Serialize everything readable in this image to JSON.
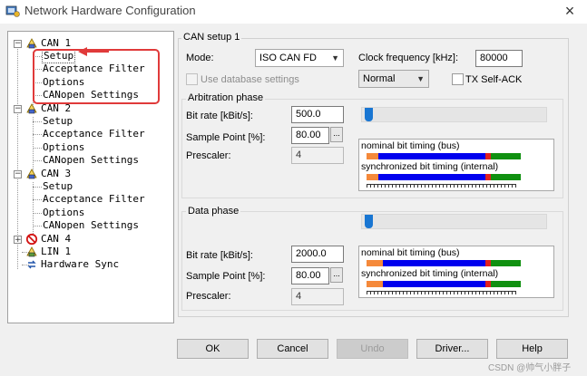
{
  "window": {
    "title": "Network Hardware Configuration",
    "close_glyph": "×"
  },
  "tree": {
    "nodes": [
      {
        "label": "CAN 1"
      },
      {
        "label": "Setup"
      },
      {
        "label": "Acceptance Filter"
      },
      {
        "label": "Options"
      },
      {
        "label": "CANopen Settings"
      },
      {
        "label": "CAN 2"
      },
      {
        "label": "Setup"
      },
      {
        "label": "Acceptance Filter"
      },
      {
        "label": "Options"
      },
      {
        "label": "CANopen Settings"
      },
      {
        "label": "CAN 3"
      },
      {
        "label": "Setup"
      },
      {
        "label": "Acceptance Filter"
      },
      {
        "label": "Options"
      },
      {
        "label": "CANopen Settings"
      },
      {
        "label": "CAN 4"
      },
      {
        "label": "LIN 1"
      },
      {
        "label": "Hardware Sync"
      }
    ],
    "expand_minus": "−",
    "expand_plus": "+"
  },
  "setup": {
    "group_title": "CAN setup 1",
    "mode_label": "Mode:",
    "mode_value": "ISO CAN FD",
    "clock_label": "Clock frequency [kHz]:",
    "clock_value": "80000",
    "use_db_label": "Use database settings",
    "normal_value": "Normal",
    "tx_self_ack_label": "TX Self-ACK",
    "arbitration": {
      "title": "Arbitration phase",
      "bitrate_label": "Bit rate [kBit/s]:",
      "bitrate_value": "500.0",
      "sample_label": "Sample Point [%]:",
      "sample_value": "80.00",
      "prescaler_label": "Prescaler:",
      "prescaler_value": "4",
      "nominal_label": "nominal bit timing (bus)",
      "sync_label": "synchronized bit timing (internal)",
      "slider_level": 0.01
    },
    "data_phase": {
      "title": "Data phase",
      "bitrate_label": "Bit rate [kBit/s]:",
      "bitrate_value": "2000.0",
      "sample_label": "Sample Point [%]:",
      "sample_value": "80.00",
      "prescaler_label": "Prescaler:",
      "prescaler_value": "4",
      "nominal_label": "nominal bit timing (bus)",
      "sync_label": "synchronized bit timing (internal)",
      "slider_level": 0.01
    },
    "ellipsis": "..."
  },
  "buttons": {
    "ok": "OK",
    "cancel": "Cancel",
    "undo": "Undo",
    "driver": "Driver...",
    "help": "Help"
  },
  "watermark": "CSDN @帅气小胖子",
  "colors": {
    "sync_seg": "#f5893a",
    "prop_seg": "#0000ee",
    "phase_seg": "#109010",
    "sample_marker": "#e02020",
    "slider_thumb": "#1976d2",
    "highlight": "#e03a3a"
  }
}
